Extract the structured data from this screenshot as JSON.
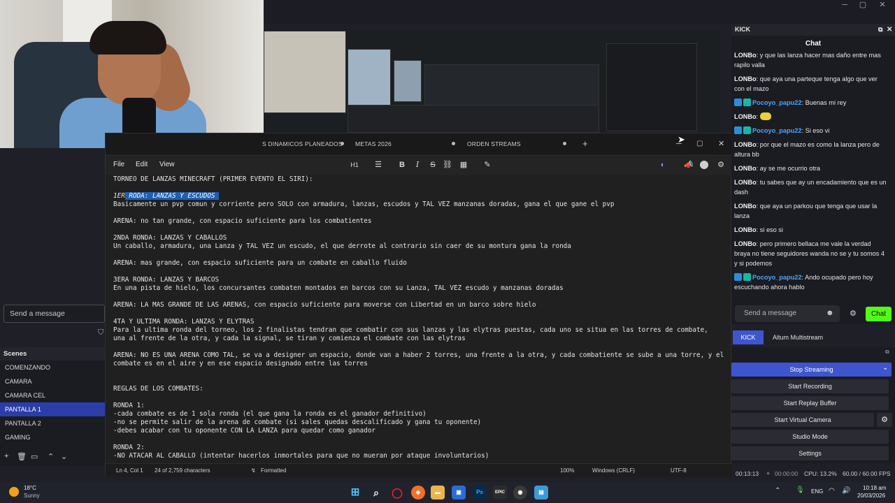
{
  "editor": {
    "tabs": [
      "S DINAMICOS PLANEADOS",
      "METAS 2026",
      "ORDEN STREAMS"
    ],
    "menu": [
      "File",
      "Edit",
      "View"
    ],
    "heading": "H1",
    "lines": [
      "TORNEO DE LANZAS MINECRAFT (PRIMER EVENTO EL SIRI):",
      "",
      "1ER RODA: LANZAS Y ESCUDOS",
      "Basicamente un pvp comun y corriente pero SOLO con armadura, lanzas, escudos y TAL VEZ manzanas doradas, gana el que gane el pvp",
      "",
      "ARENA: no tan grande, con espacio suficiente para los combatientes",
      "",
      "2NDA RONDA: LANZAS Y CABALLOS",
      "Un caballo, armadura, una Lanza y TAL VEZ un escudo, el que derrote al contrario sin caer de su montura gana la ronda",
      "",
      "ARENA: mas grande, con espacio suficiente para un combate en caballo fluido",
      "",
      "3ERA RONDA: LANZAS Y BARCOS",
      "En una pista de hielo, los concursantes combaten montados en barcos con su Lanza, TAL VEZ escudo y manzanas doradas",
      "",
      "ARENA: LA MAS GRANDE DE LAS ARENAS, con espacio suficiente para moverse con Libertad en un barco sobre hielo",
      "",
      "4TA Y ULTIMA RONDA: LANZAS Y ELYTRAS",
      "Para la ultima ronda del torneo, los 2 finalistas tendran que combatir con sus lanzas y las elytras puestas, cada uno se situa en las torres de combate,",
      "una al frente de la otra, y cada la signal, se tiran y comienza el combate con las elytras",
      "",
      "ARENA: NO ES UNA ARENA COMO TAL, se va a designer un espacio, donde van a haber 2 torres, una frente a la otra, y cada combatiente se sube a una torre, y el",
      "combate es en el aire y en ese espacio designado entre las torres",
      "",
      "",
      "REGLAS DE LOS COMBATES:",
      "",
      "RONDA 1:",
      "-cada combate es de 1 sola ronda (el que gana la ronda es el ganador definitivo)",
      "-no se permite salir de la arena de combate (si sales quedas descalificado y gana tu oponente)",
      "-debes acabar con tu oponente CON LA LANZA para quedar como ganador",
      "",
      "RONDA 2:",
      "-NO ATACAR AL CABALLO (intentar hacerlos inmortales para que no mueran por ataque involuntarios)"
    ],
    "status": {
      "position": "Ln 4, Col 1",
      "chars": "24 of 2,759 characters",
      "mode": "Formatted",
      "zoom": "100%",
      "eol": "Windows (CRLF)",
      "encoding": "UTF-8"
    }
  },
  "left": {
    "send_placeholder": "Send a message",
    "scenes_title": "Scenes",
    "scenes": [
      "COMENZANDO",
      "CAMARA",
      "CAMARA CEL",
      "PANTALLA 1",
      "PANTALLA 2",
      "GAMING"
    ],
    "active_scene": "PANTALLA 1"
  },
  "chat": {
    "dock_title": "KICK",
    "header": "Chat",
    "messages": [
      {
        "user": "LONBo",
        "badges": false,
        "text": "y que las lanza hacer mas daño entre mas rapilo valla"
      },
      {
        "user": "LONBo",
        "badges": false,
        "text": "que aya una parteque tenga algo que ver con el mazo"
      },
      {
        "user": "Pocoyo_papu22",
        "badges": true,
        "text": "Buenas mi rey"
      },
      {
        "user": "LONBo",
        "badges": false,
        "text": "",
        "emote": true
      },
      {
        "user": "Pocoyo_papu22",
        "badges": true,
        "text": "Si eso vi"
      },
      {
        "user": "LONBo",
        "badges": false,
        "text": "por que el mazo es como la lanza pero de altura bb"
      },
      {
        "user": "LONBo",
        "badges": false,
        "text": "ay se me ocurrio otra"
      },
      {
        "user": "LONBo",
        "badges": false,
        "text": "tu sabes que ay un encadamiento que es un dash"
      },
      {
        "user": "LONBo",
        "badges": false,
        "text": "que aya un parkou que tenga que usar la lanza"
      },
      {
        "user": "LONBo",
        "badges": false,
        "text": "si eso si"
      },
      {
        "user": "LONBo",
        "badges": false,
        "text": "pero primero bellaca me vale la verdad braya no tiene seguidores wanda no se y tu somos 4 y si podemos"
      },
      {
        "user": "Pocoyo_papu22",
        "badges": true,
        "text": "Ando ocupado pero hoy escuchando ahora hablo"
      }
    ],
    "input_placeholder": "Send a message",
    "send_label": "Chat",
    "dock_tabs": [
      "KICK",
      "Altum Multistream"
    ]
  },
  "controls": {
    "buttons": [
      "Stop Streaming",
      "Start Recording",
      "Start Replay Buffer",
      "Start Virtual Camera",
      "Studio Mode",
      "Settings"
    ]
  },
  "obs_status": {
    "stream_time": "00:13:13",
    "rec_time": "00:00:00",
    "cpu": "CPU: 13.2%",
    "fps": "60.00 / 60.00 FPS"
  },
  "taskbar": {
    "weather_temp": "18°C",
    "weather_desc": "Sunny",
    "lang": "ENG",
    "time": "10:18 am",
    "date": "20/03/2026"
  },
  "colors": {
    "accent_stream": "#3e55cf",
    "kick_green": "#53fc18",
    "selection": "#1f5fb0"
  }
}
